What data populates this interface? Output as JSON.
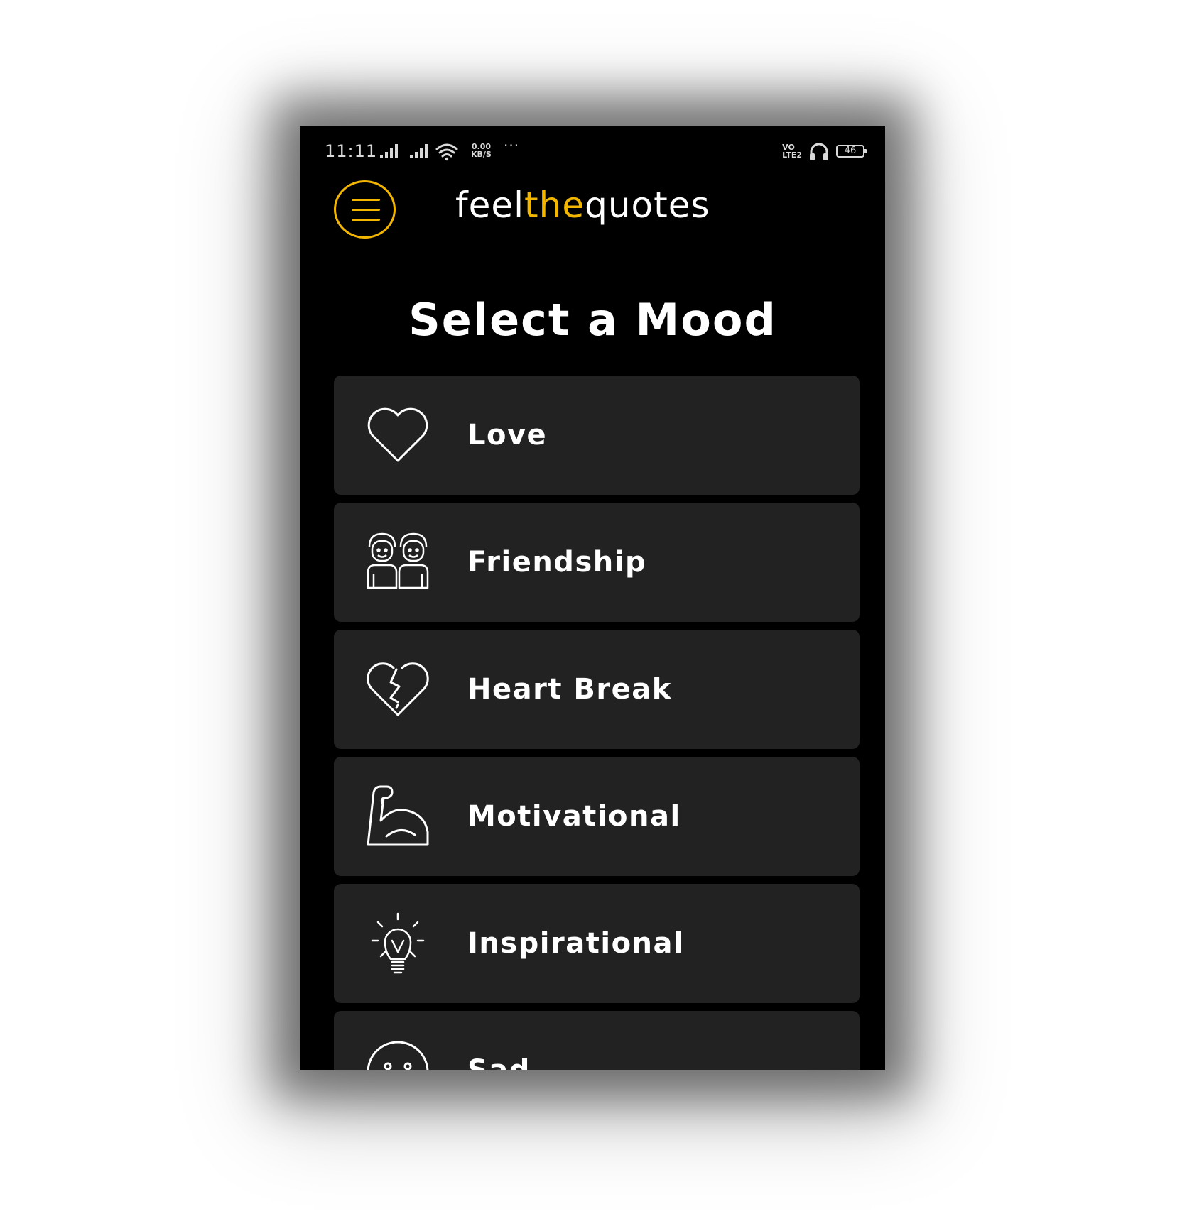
{
  "status_bar": {
    "time": "11:11",
    "speed_value": "0.00",
    "speed_unit": "KB/S",
    "more": "···",
    "volte_top": "VO",
    "volte_bottom": "LTE2",
    "battery": "46"
  },
  "app_bar": {
    "title_part1": "feel",
    "title_part2": "the",
    "title_part3": "quotes"
  },
  "page": {
    "title": "Select a Mood"
  },
  "moods": [
    {
      "label": "Love",
      "icon": "heart-icon"
    },
    {
      "label": "Friendship",
      "icon": "friends-icon"
    },
    {
      "label": "Heart Break",
      "icon": "broken-heart-icon"
    },
    {
      "label": "Motivational",
      "icon": "flexed-arm-icon"
    },
    {
      "label": "Inspirational",
      "icon": "lightbulb-icon"
    },
    {
      "label": "Sad",
      "icon": "sad-face-icon"
    }
  ],
  "colors": {
    "accent": "#f2b500",
    "background": "#000000",
    "card": "#222222",
    "text": "#ffffff"
  }
}
